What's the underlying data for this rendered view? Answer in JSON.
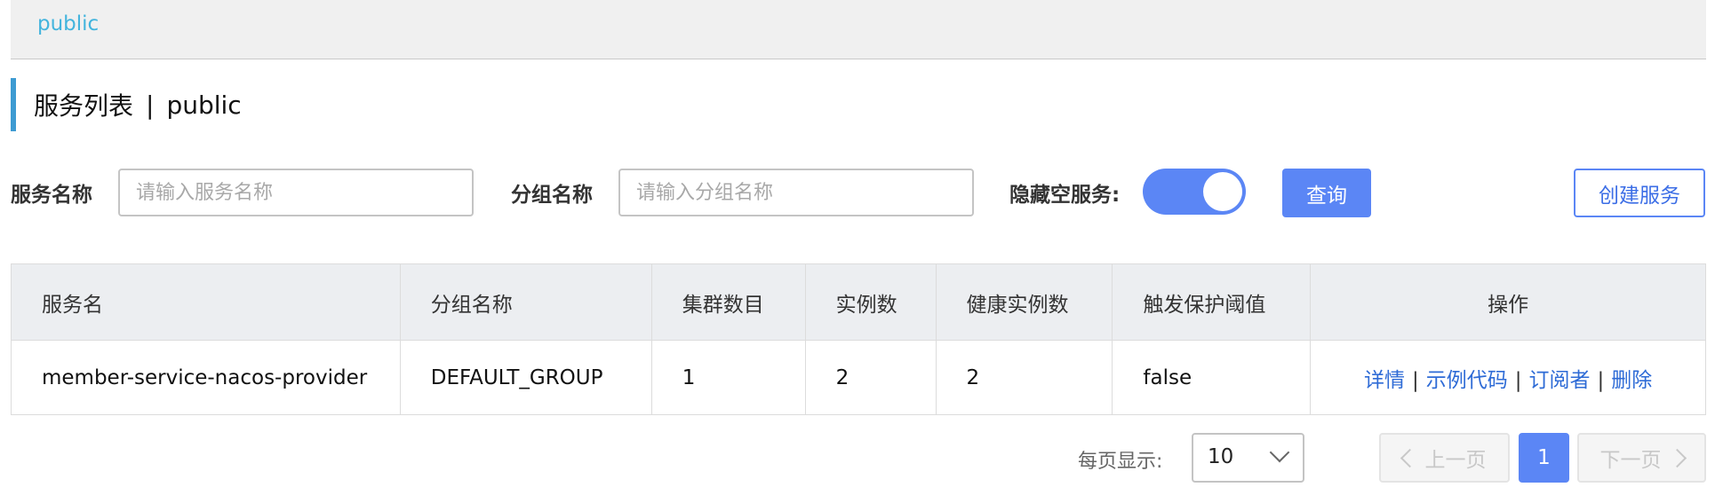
{
  "namespace_bar": {
    "active_namespace": "public"
  },
  "page_title": {
    "title": "服务列表",
    "separator": "|",
    "namespace": "public"
  },
  "filters": {
    "service_name_label": "服务名称",
    "service_name_placeholder": "请输入服务名称",
    "service_name_value": "",
    "group_name_label": "分组名称",
    "group_name_placeholder": "请输入分组名称",
    "group_name_value": "",
    "hide_empty_label": "隐藏空服务:",
    "hide_empty_on": true,
    "query_button": "查询",
    "create_button": "创建服务"
  },
  "table": {
    "headers": [
      "服务名",
      "分组名称",
      "集群数目",
      "实例数",
      "健康实例数",
      "触发保护阈值",
      "操作"
    ],
    "rows": [
      {
        "service_name": "member-service-nacos-provider",
        "group_name": "DEFAULT_GROUP",
        "cluster_count": "1",
        "instance_count": "2",
        "healthy_instance_count": "2",
        "protect_threshold": "false"
      }
    ],
    "operations": [
      "详情",
      "示例代码",
      "订阅者",
      "删除"
    ],
    "operation_separator": "|"
  },
  "pagination": {
    "page_size_label": "每页显示:",
    "page_size": "10",
    "prev_label": "上一页",
    "current_page": "1",
    "next_label": "下一页"
  },
  "colors": {
    "primary": "#5b86f5",
    "link": "#2e6bd6",
    "namespace_link": "#43b4dd",
    "title_accent": "#3e9bd2",
    "header_bg": "#eceef1"
  }
}
